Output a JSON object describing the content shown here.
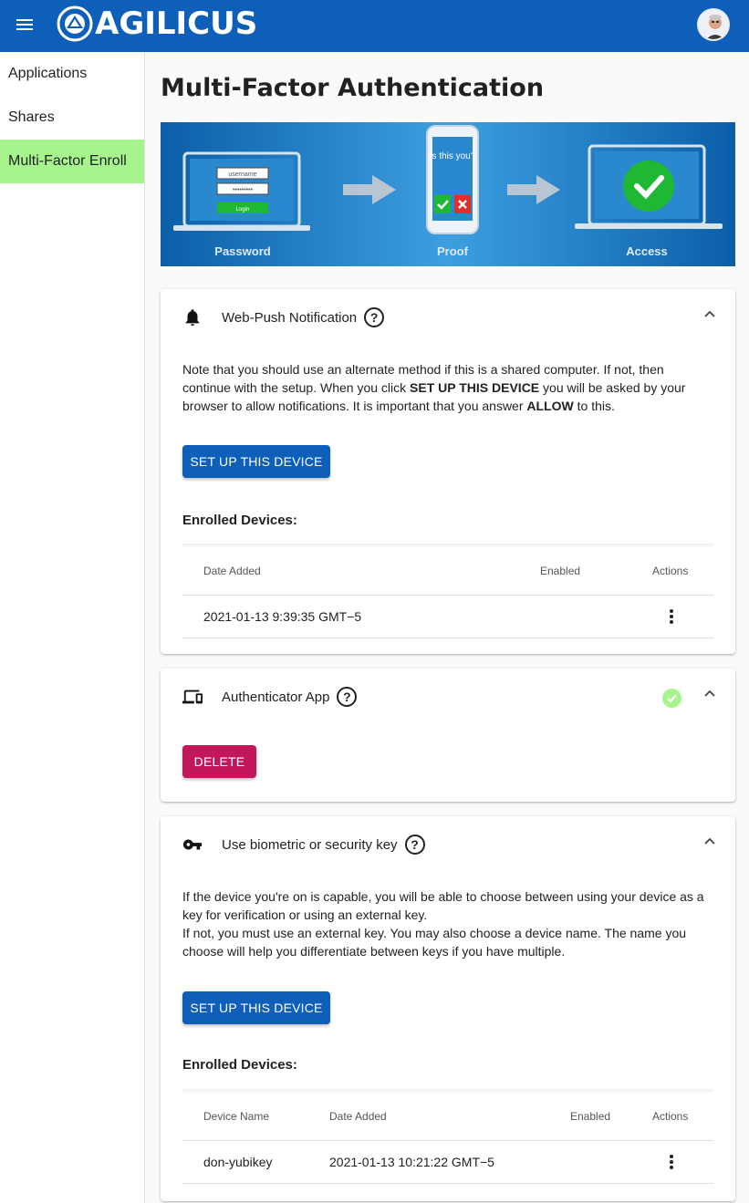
{
  "app": {
    "brand": "AGILICUS",
    "menu_icon": "menu-icon",
    "avatar_alt": "user-avatar"
  },
  "sidebar": {
    "items": [
      {
        "label": "Applications",
        "active": false
      },
      {
        "label": "Shares",
        "active": false
      },
      {
        "label": "Multi-Factor Enroll",
        "active": true
      }
    ]
  },
  "page": {
    "title": "Multi-Factor Authentication"
  },
  "banner": {
    "login_field_1": "username",
    "login_field_2": "•••••••••",
    "login_button": "Login",
    "phone_text": "Is this you?",
    "caption_1": "Password",
    "caption_2": "Proof",
    "caption_3": "Access"
  },
  "webpush": {
    "title": "Web-Push Notification",
    "help": "?",
    "desc_1": "Note that you should use an alternate method if this is a shared computer. If not, then continue with the setup. When you click ",
    "desc_bold_1": "SET UP THIS DEVICE",
    "desc_2": " you will be asked by your browser to allow notifications. It is important that you answer ",
    "desc_bold_2": "ALLOW",
    "desc_3": " to this.",
    "setup_button": "SET UP THIS DEVICE",
    "enrolled_title": "Enrolled Devices:",
    "columns": [
      "Date Added",
      "Enabled",
      "Actions"
    ],
    "rows": [
      {
        "date_added": "2021-01-13 9:39:35 GMT−5"
      }
    ]
  },
  "authenticator": {
    "title": "Authenticator App",
    "help": "?",
    "status": "enabled",
    "delete_button": "DELETE"
  },
  "security_key": {
    "title": "Use biometric or security key",
    "help": "?",
    "desc_1": "If the device you're on is capable, you will be able to choose between using your device as a key for verification or using an external key.",
    "desc_2": "If not, you must use an external key. You may also choose a device name. The name you choose will help you differentiate between keys if you have multiple.",
    "setup_button": "SET UP THIS DEVICE",
    "enrolled_title": "Enrolled Devices:",
    "columns": [
      "Device Name",
      "Date Added",
      "Enabled",
      "Actions"
    ],
    "rows": [
      {
        "device_name": "don-yubikey",
        "date_added": "2021-01-13 10:21:22 GMT−5"
      }
    ]
  },
  "colors": {
    "topbar": "#0d5fb9",
    "active_nav": "#a6f58c",
    "primary_button": "#0d5fb9",
    "danger_button": "#c2185b",
    "status_ok": "#a6f58c"
  }
}
